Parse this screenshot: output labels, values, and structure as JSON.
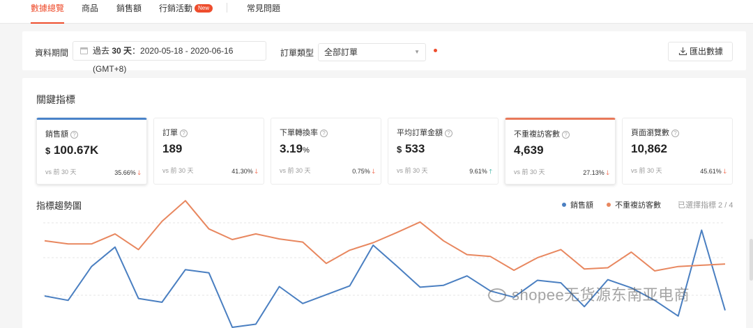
{
  "tabs": [
    {
      "label": "數據總覽",
      "active": true
    },
    {
      "label": "商品",
      "active": false
    },
    {
      "label": "銷售額",
      "active": false
    },
    {
      "label": "行銷活動",
      "active": false,
      "badge": "New"
    },
    {
      "label": "常見問題",
      "active": false
    }
  ],
  "filters": {
    "period_label": "資料期間",
    "period_prefix": "過去",
    "period_days": "30 天",
    "period_range": "：2020-05-18 - 2020-06-16 (GMT+8)",
    "order_type_label": "訂單類型",
    "order_type_value": "全部訂單",
    "export_label": "匯出數據"
  },
  "metrics_section": {
    "title": "關鍵指標",
    "cards": [
      {
        "label": "銷售額",
        "prefix": "$",
        "value": "100.67K",
        "suffix": "",
        "compare": "vs 前 30 天",
        "change": "35.66%",
        "direction": "down"
      },
      {
        "label": "訂單",
        "prefix": "",
        "value": "189",
        "suffix": "",
        "compare": "vs 前 30 天",
        "change": "41.30%",
        "direction": "down"
      },
      {
        "label": "下單轉換率",
        "prefix": "",
        "value": "3.19",
        "suffix": "%",
        "compare": "vs 前 30 天",
        "change": "0.75%",
        "direction": "down"
      },
      {
        "label": "平均訂單金額",
        "prefix": "$",
        "value": "533",
        "suffix": "",
        "compare": "vs 前 30 天",
        "change": "9.61%",
        "direction": "up"
      },
      {
        "label": "不重複訪客數",
        "prefix": "",
        "value": "4,639",
        "suffix": "",
        "compare": "vs 前 30 天",
        "change": "27.13%",
        "direction": "down"
      },
      {
        "label": "頁面瀏覽數",
        "prefix": "",
        "value": "10,862",
        "suffix": "",
        "compare": "vs 前 30 天",
        "change": "45.61%",
        "direction": "down"
      }
    ]
  },
  "trend": {
    "title": "指標趨勢圖",
    "legend": [
      {
        "name": "銷售額",
        "color": "#4a7fc1"
      },
      {
        "name": "不重複訪客數",
        "color": "#e8875f"
      }
    ],
    "selected_text": "已選擇指標 2 / 4"
  },
  "chart_data": {
    "type": "line",
    "title": "指標趨勢圖",
    "grid": true,
    "legend_position": "top-right",
    "series": [
      {
        "name": "銷售額",
        "color": "#4a7fc1",
        "values": [
          50,
          43,
          97,
          128,
          46,
          40,
          92,
          87,
          0,
          5,
          65,
          38,
          52,
          66,
          131,
          98,
          64,
          67,
          82,
          58,
          48,
          75,
          71,
          33,
          76,
          63,
          43,
          18,
          155,
          27
        ]
      },
      {
        "name": "不重複訪客數",
        "color": "#e8875f",
        "values": [
          138,
          133,
          133,
          149,
          124,
          169,
          202,
          157,
          140,
          149,
          141,
          136,
          102,
          123,
          135,
          151,
          168,
          138,
          116,
          113,
          91,
          111,
          124,
          93,
          95,
          120,
          90,
          97,
          99,
          101
        ]
      }
    ]
  },
  "watermark": {
    "text": "shopee无货源东南亚电商"
  }
}
